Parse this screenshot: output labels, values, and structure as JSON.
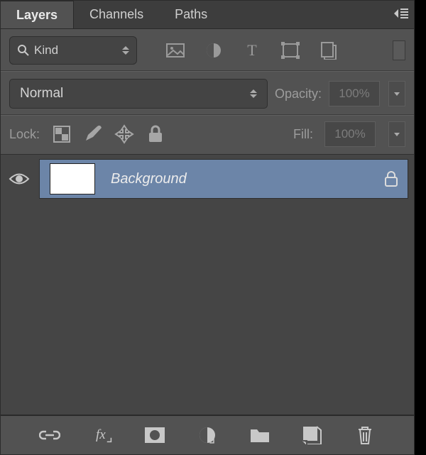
{
  "tabs": {
    "layers": "Layers",
    "channels": "Channels",
    "paths": "Paths",
    "active": "layers"
  },
  "filter": {
    "label": "Kind"
  },
  "blend": {
    "mode": "Normal",
    "opacity_label": "Opacity:",
    "opacity_value": "100%"
  },
  "lock": {
    "label": "Lock:",
    "fill_label": "Fill:",
    "fill_value": "100%"
  },
  "layers": [
    {
      "name": "Background",
      "visible": true,
      "locked": true,
      "selected": true
    }
  ]
}
